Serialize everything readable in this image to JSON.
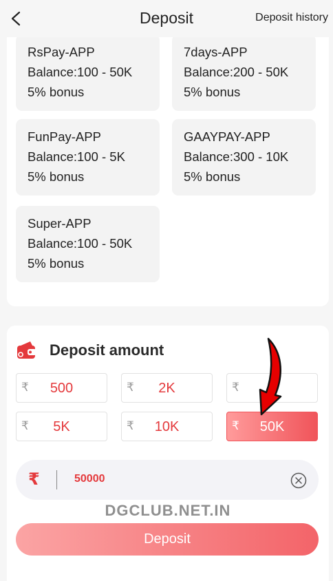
{
  "header": {
    "title": "Deposit",
    "history_label": "Deposit history"
  },
  "channels": [
    {
      "name": "RsPay-APP",
      "balance": "Balance:100 - 50K",
      "bonus": "5% bonus"
    },
    {
      "name": "7days-APP",
      "balance": "Balance:200 - 50K",
      "bonus": "5% bonus"
    },
    {
      "name": "FunPay-APP",
      "balance": "Balance:100 - 5K",
      "bonus": "5% bonus"
    },
    {
      "name": "GAAYPAY-APP",
      "balance": "Balance:300 - 10K",
      "bonus": "5% bonus"
    },
    {
      "name": "Super-APP",
      "balance": "Balance:100 - 50K",
      "bonus": "5% bonus"
    }
  ],
  "amount_section": {
    "title": "Deposit amount",
    "currency_symbol": "₹",
    "presets": [
      {
        "label": "500"
      },
      {
        "label": "2K"
      },
      {
        "label": ""
      },
      {
        "label": "5K"
      },
      {
        "label": "10K"
      },
      {
        "label": "50K",
        "selected": true
      }
    ],
    "input_value": "50000",
    "watermark": "DGCLUB.NET.IN",
    "submit_label": "Deposit"
  },
  "colors": {
    "accent": "#e4393c",
    "button_gradient_start": "#fba4a4",
    "button_gradient_end": "#f36469",
    "card_bg": "#f3f3f3",
    "page_bg": "#f6f6f6"
  }
}
